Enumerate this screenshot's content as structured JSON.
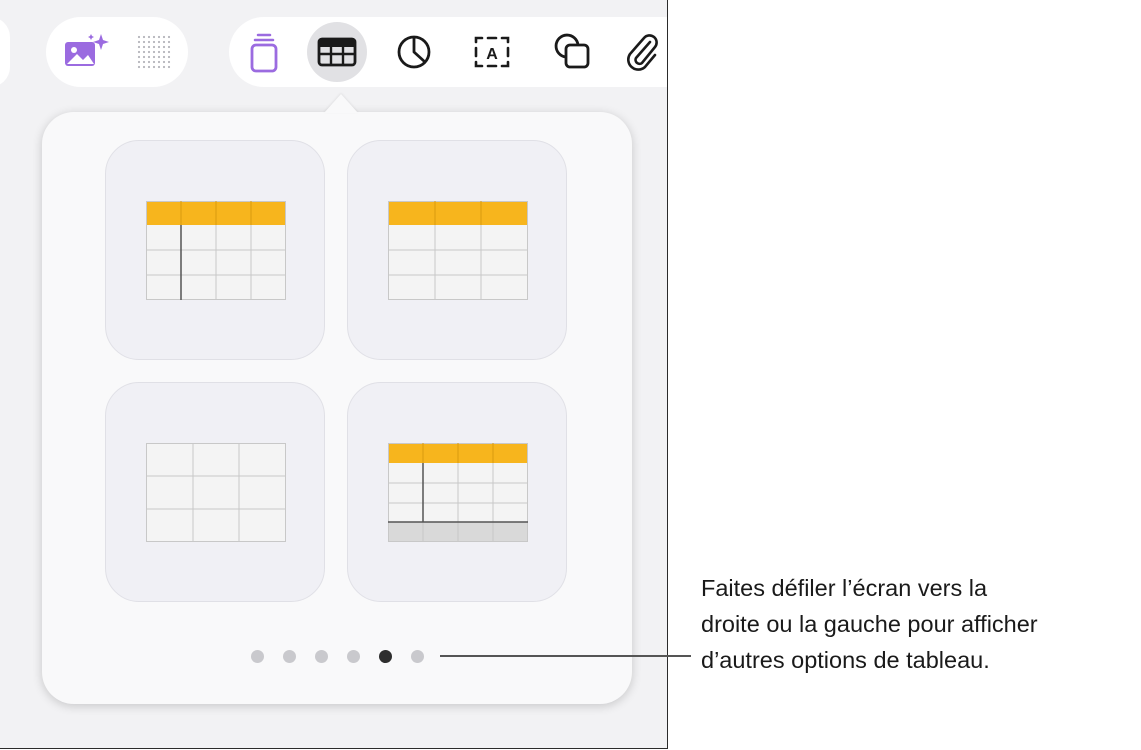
{
  "toolbar": {
    "items": [
      {
        "name": "image-generation-icon",
        "selected": false
      },
      {
        "name": "dot-grid-icon",
        "selected": false
      },
      {
        "name": "text-box-stack-icon",
        "selected": false
      },
      {
        "name": "table-icon",
        "selected": true
      },
      {
        "name": "chart-icon",
        "selected": false
      },
      {
        "name": "text-icon",
        "selected": false
      },
      {
        "name": "shapes-icon",
        "selected": false
      },
      {
        "name": "paperclip-icon",
        "selected": false
      }
    ],
    "text_icon_letter": "A",
    "accent": "#9b6be0"
  },
  "popover": {
    "header_fill": "#f7b51d",
    "tables": [
      {
        "style": "header-row-and-column"
      },
      {
        "style": "header-row"
      },
      {
        "style": "plain"
      },
      {
        "style": "header-column-and-footer"
      }
    ],
    "page_count": 6,
    "active_page": 5
  },
  "callout": {
    "lines": [
      "Faites défiler l’écran vers la",
      "droite ou la gauche pour afficher",
      "d’autres options de tableau."
    ]
  }
}
